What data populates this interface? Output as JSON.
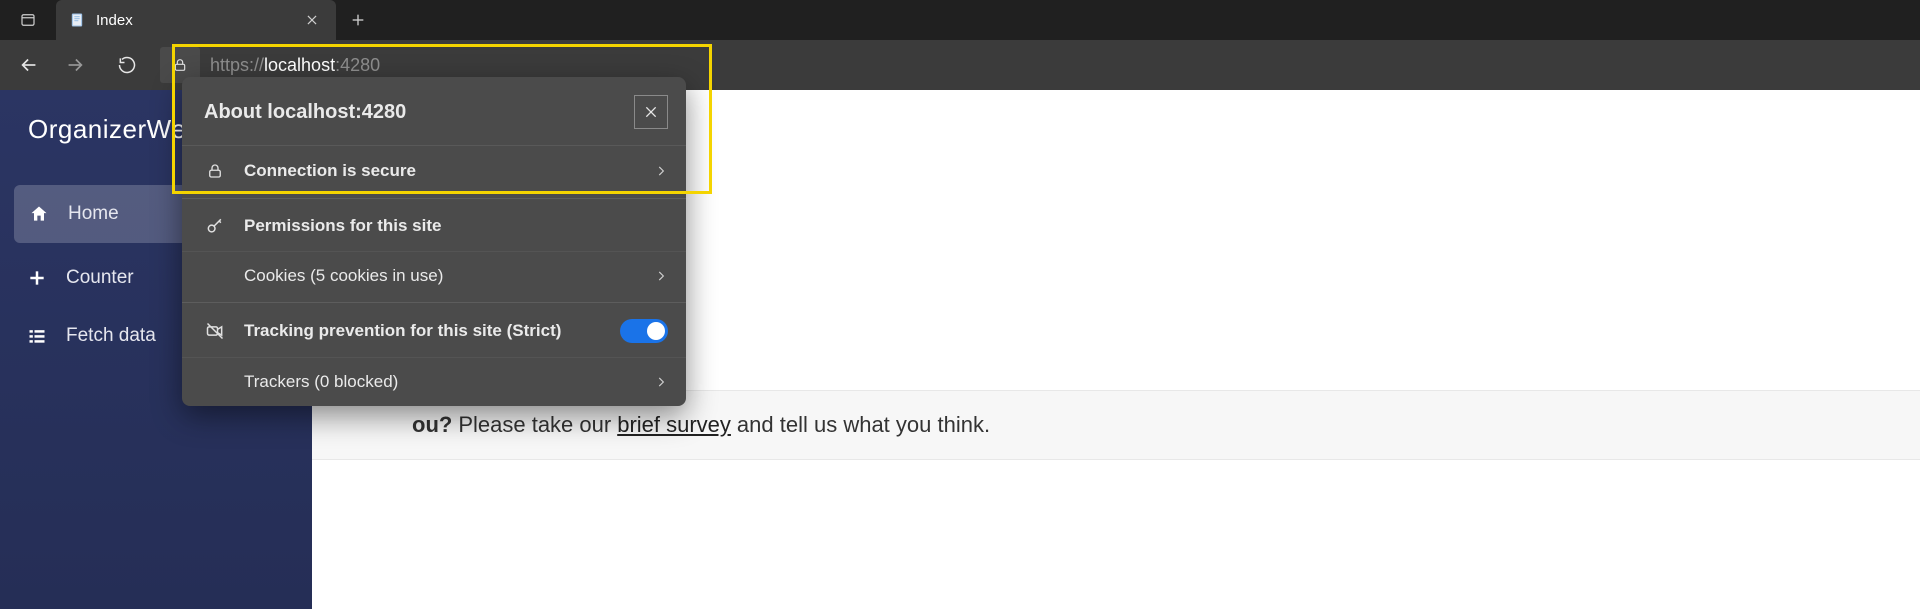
{
  "browser": {
    "tab": {
      "title": "Index"
    },
    "url": {
      "scheme": "https://",
      "host": "localhost",
      "port": ":4280"
    }
  },
  "sidebar": {
    "brand": "OrganizerWeb",
    "items": [
      {
        "label": "Home"
      },
      {
        "label": "Counter"
      },
      {
        "label": "Fetch data"
      }
    ]
  },
  "popover": {
    "title": "About localhost:4280",
    "rows": {
      "secure": "Connection is secure",
      "permissions": "Permissions for this site",
      "cookies": "Cookies (5 cookies in use)",
      "tracking": "Tracking prevention for this site (Strict)",
      "trackers": "Trackers (0 blocked)"
    }
  },
  "survey": {
    "prefix_bold": "ou?",
    "middle": " Please take our ",
    "link": "brief survey",
    "suffix": " and tell us what you think."
  }
}
